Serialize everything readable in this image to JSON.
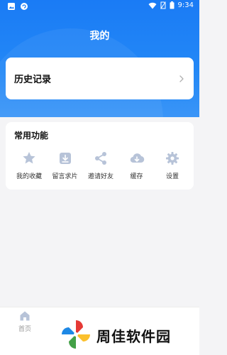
{
  "status_bar": {
    "time": "9:34"
  },
  "header": {
    "title": "我的"
  },
  "history": {
    "label": "历史记录"
  },
  "functions": {
    "title": "常用功能",
    "items": [
      {
        "label": "我的收藏",
        "icon": "star-icon"
      },
      {
        "label": "留言求片",
        "icon": "download-box-icon"
      },
      {
        "label": "邀请好友",
        "icon": "share-icon"
      },
      {
        "label": "缓存",
        "icon": "cloud-download-icon"
      },
      {
        "label": "设置",
        "icon": "gear-icon"
      }
    ]
  },
  "tabbar": {
    "home_label": "首页"
  },
  "watermark": {
    "text": "周佳软件园"
  },
  "colors": {
    "primary": "#1a7bf5",
    "icon_tint": "#b7c3d8",
    "background": "#f4f4f6"
  }
}
